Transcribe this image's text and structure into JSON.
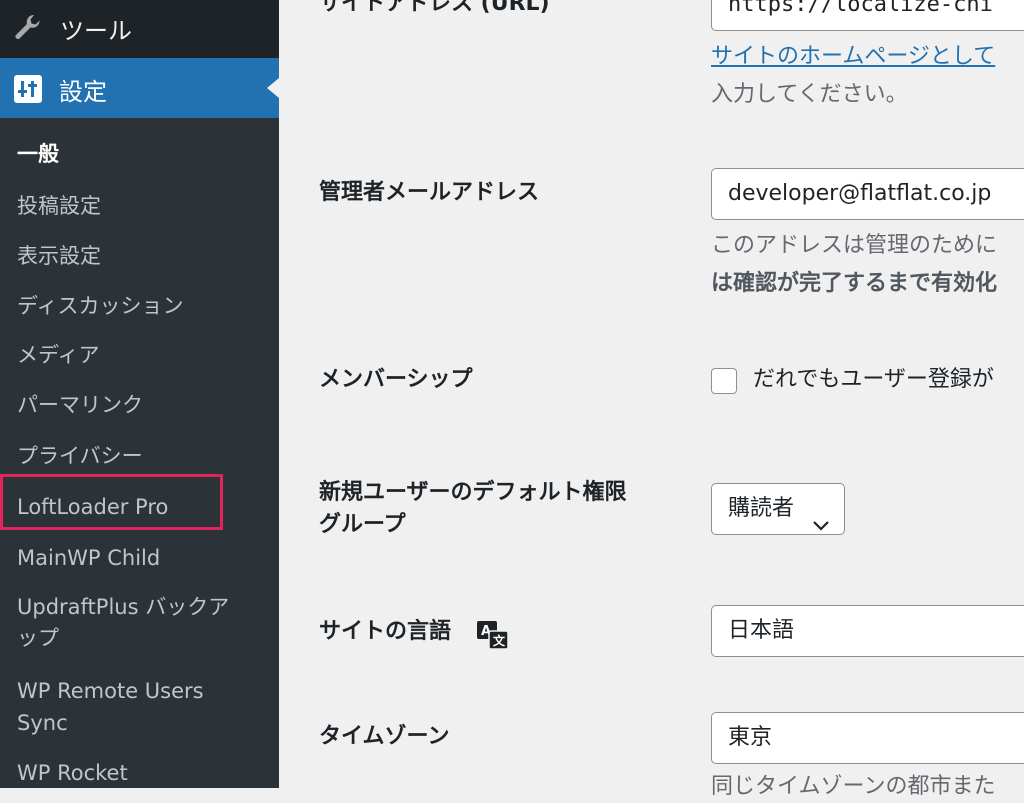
{
  "sidebar": {
    "tools_label": "ツール",
    "settings_label": "設定",
    "submenu": [
      {
        "label": "一般",
        "current": true
      },
      {
        "label": "投稿設定"
      },
      {
        "label": "表示設定"
      },
      {
        "label": "ディスカッション"
      },
      {
        "label": "メディア"
      },
      {
        "label": "パーマリンク"
      },
      {
        "label": "プライバシー"
      },
      {
        "label": "LoftLoader Pro",
        "highlighted": true
      },
      {
        "label": "MainWP Child"
      },
      {
        "label": "UpdraftPlus バックア",
        "label2": "ップ"
      },
      {
        "label": "WP Remote Users",
        "label2": "Sync"
      },
      {
        "label": "WP Rocket"
      }
    ],
    "highlight_color": "#e0245e"
  },
  "form": {
    "site_address": {
      "label": "サイトアドレス (URL)",
      "value": "https://localize-chi",
      "desc_link": "サイトのホームページとして",
      "desc_line2": "入力してください。"
    },
    "admin_email": {
      "label": "管理者メールアドレス",
      "value": "developer@flatflat.co.jp",
      "desc_line1": "このアドレスは管理のために",
      "desc_line2": "は確認が完了するまで有効化"
    },
    "membership": {
      "label": "メンバーシップ",
      "checkbox_label": "だれでもユーザー登録が"
    },
    "default_role": {
      "label_line1": "新規ユーザーのデフォルト権限",
      "label_line2": "グループ",
      "selected": "購読者"
    },
    "site_language": {
      "label": "サイトの言語",
      "value": "日本語"
    },
    "timezone": {
      "label": "タイムゾーン",
      "value": "東京",
      "desc": "同じタイムゾーンの都市また"
    }
  }
}
